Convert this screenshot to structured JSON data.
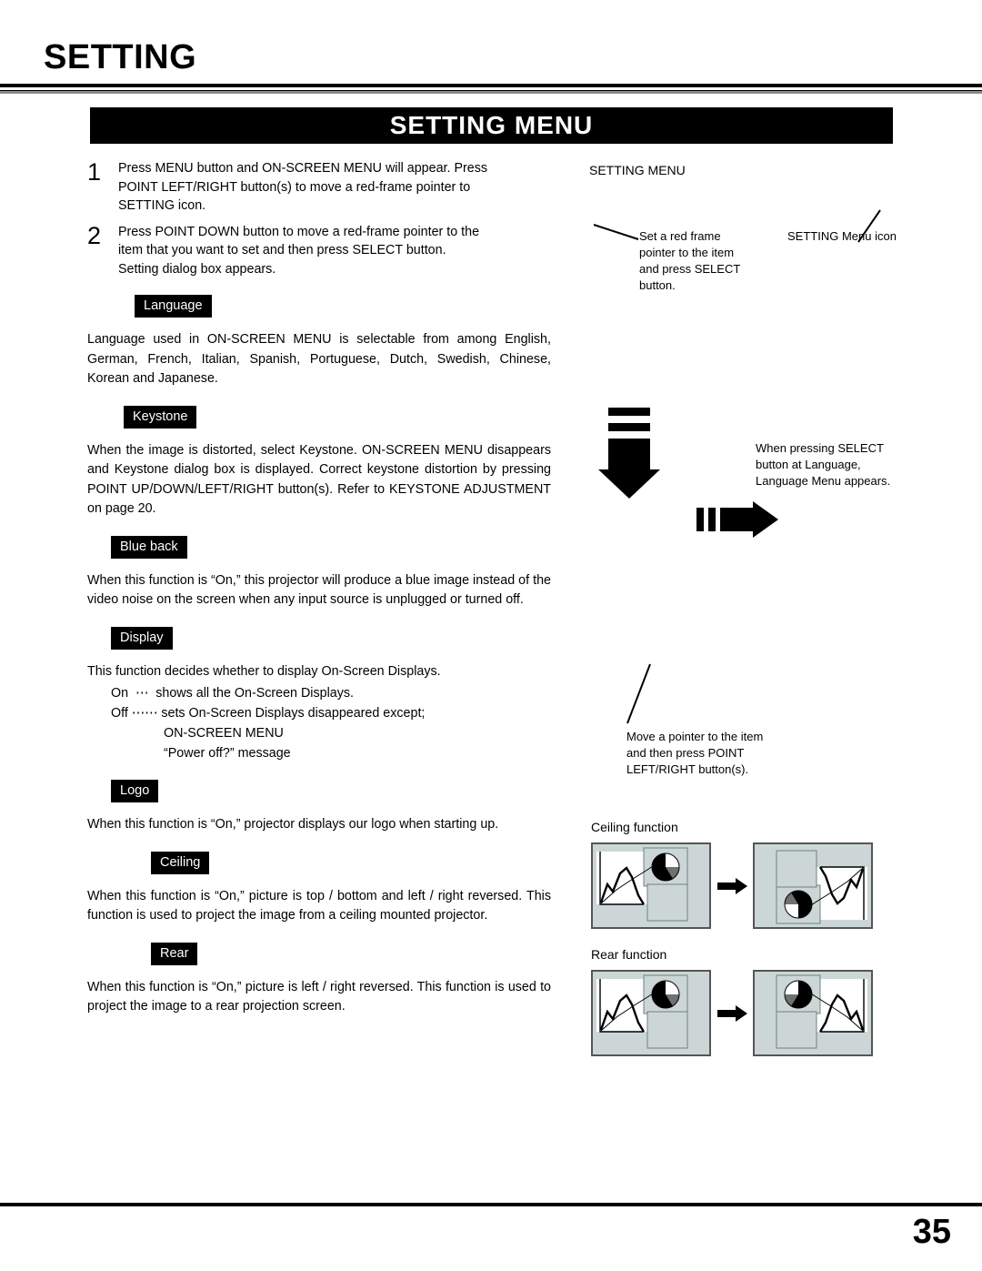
{
  "page": {
    "title": "SETTING",
    "number": "35"
  },
  "banner": {
    "label": "SETTING MENU"
  },
  "steps": [
    {
      "num": "1",
      "lines": [
        "Press MENU button and ON-SCREEN MENU will appear.  Press",
        "POINT LEFT/RIGHT button(s) to move a red-frame pointer to",
        "SETTING icon."
      ]
    },
    {
      "num": "2",
      "lines": [
        "Press POINT DOWN button to move a red-frame pointer to the",
        "item that you want to set and then press SELECT button.",
        "Setting dialog box appears."
      ]
    }
  ],
  "sections": [
    {
      "tag": "Language",
      "lines": [
        "Language used in ON-SCREEN MENU is selectable from among",
        "English, German, French, Italian, Spanish, Portuguese, Dutch,",
        "Swedish, Chinese, Korean and Japanese."
      ]
    },
    {
      "tag": "Keystone",
      "lines": [
        "When the image is distorted, select Keystone.  ON-SCREEN MENU",
        "disappears and Keystone dialog box is displayed.  Correct keystone",
        "distortion by pressing POINT UP/DOWN/LEFT/RIGHT button(s).",
        "Refer to KEYSTONE ADJUSTMENT on page 20."
      ]
    },
    {
      "tag": "Blue back",
      "lines": [
        "When this function is “On,” this projector will produce a blue image",
        "instead of the video noise on the screen when any input source is",
        "unplugged or turned off."
      ]
    },
    {
      "tag": "Display",
      "lines": [
        "This function decides whether to display On-Screen Displays."
      ],
      "sub_lines": [
        {
          "indent": 1,
          "text": "On  ⋯  shows all the On-Screen Displays."
        },
        {
          "indent": 1,
          "text": "Off ⋯⋯ sets On-Screen Displays disappeared except;"
        },
        {
          "indent": 2,
          "text": "ON-SCREEN MENU"
        },
        {
          "indent": 2,
          "text": "“Power off?” message"
        }
      ]
    },
    {
      "tag": "Logo",
      "lines": [
        "When this function is “On,” projector displays our logo when starting",
        "up."
      ]
    },
    {
      "tag": "Ceiling",
      "lines": [
        "When this function is “On,” picture is top / bottom and left / right",
        "reversed.  This function is used to project the image from a ceiling",
        "mounted projector."
      ]
    },
    {
      "tag": "Rear",
      "lines": [
        "When this function is “On,” picture is left / right reversed.  This",
        "function is used to project the image to a rear projection screen."
      ]
    }
  ],
  "right_column": {
    "menu_heading": "SETTING MENU",
    "callout_red_frame": [
      "Set a red frame",
      "pointer to the item",
      "and press SELECT",
      "button."
    ],
    "callout_menu_icon": "SETTING Menu icon",
    "callout_select_language": [
      "When pressing SELECT",
      "button at Language,",
      "Language Menu appears."
    ],
    "callout_move_pointer": [
      "Move a pointer to the item",
      "and then press POINT",
      "LEFT/RIGHT button(s)."
    ],
    "diagrams": [
      {
        "caption": "Ceiling function"
      },
      {
        "caption": "Rear function"
      }
    ]
  },
  "colors": {
    "banner_bg": "#000000",
    "banner_text": "#ffffff",
    "tag_bg": "#000000",
    "tag_text": "#ffffff",
    "screen_bg": "#ccd6d6",
    "screen_border": "#555555",
    "page_bg": "#ffffff",
    "text": "#000000"
  }
}
